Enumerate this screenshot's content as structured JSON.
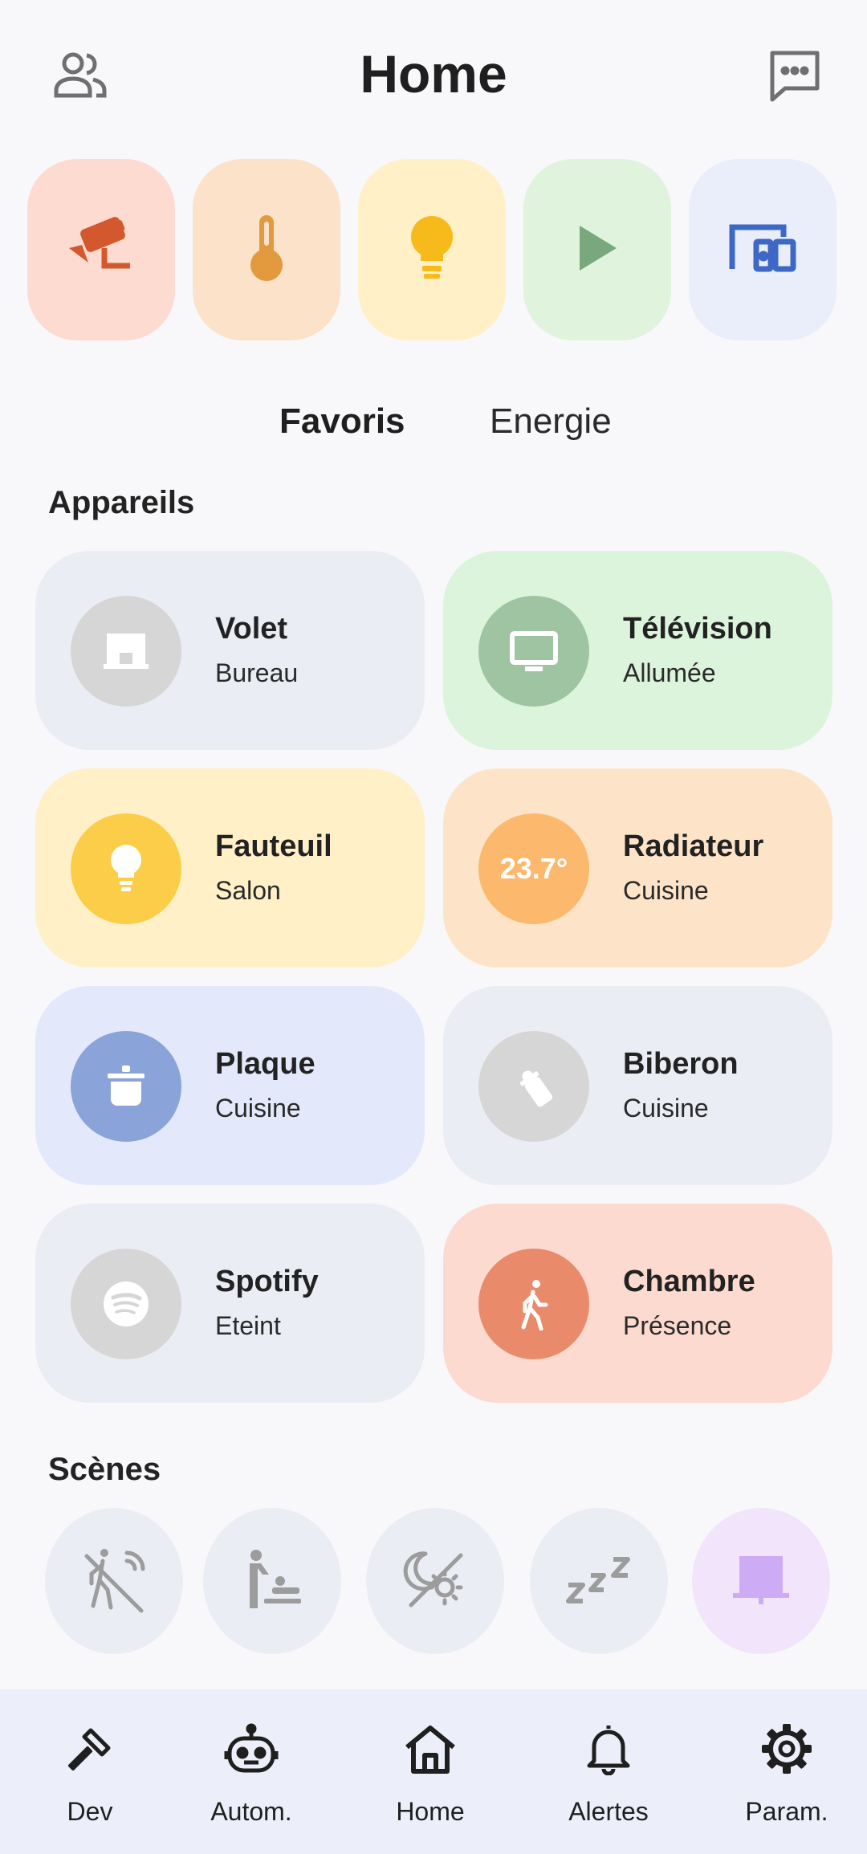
{
  "header": {
    "title": "Home",
    "left_icon": "people-icon",
    "right_icon": "message-icon"
  },
  "categories": [
    {
      "icon": "security-camera-icon",
      "bg": "#fddbd0",
      "color": "#d4582e"
    },
    {
      "icon": "thermometer-icon",
      "bg": "#fbe2c8",
      "color": "#e39a3f"
    },
    {
      "icon": "lightbulb-icon",
      "bg": "#fff0c8",
      "color": "#f6bb1b"
    },
    {
      "icon": "play-icon",
      "bg": "#dff3dd",
      "color": "#78a87c"
    },
    {
      "icon": "devices-icon",
      "bg": "#eaeefa",
      "color": "#3d68c5"
    }
  ],
  "tabs": [
    {
      "label": "Favoris",
      "active": true
    },
    {
      "label": "Energie",
      "active": false
    }
  ],
  "sections": {
    "devices": "Appareils",
    "scenes": "Scènes"
  },
  "devices": [
    {
      "name": "Volet",
      "status": "Bureau",
      "icon": "shutter-icon",
      "bg": "#eaedf4",
      "circle": "#d6d6d6"
    },
    {
      "name": "Télévision",
      "status": "Allumée",
      "icon": "tv-icon",
      "bg": "#dcf4dc",
      "circle": "#9ec4a1"
    },
    {
      "name": "Fauteuil",
      "status": "Salon",
      "icon": "lightbulb-icon",
      "bg": "#fff0c8",
      "circle": "#fbcd48"
    },
    {
      "name": "Radiateur",
      "status": "Cuisine",
      "icon": "temperature-readout",
      "temp": "23.7°",
      "bg": "#fde4c8",
      "circle": "#fcb96d"
    },
    {
      "name": "Plaque",
      "status": "Cuisine",
      "icon": "cooking-pot-icon",
      "bg": "#e3e8fb",
      "circle": "#8aa3d8"
    },
    {
      "name": "Biberon",
      "status": "Cuisine",
      "icon": "baby-bottle-icon",
      "bg": "#eaedf4",
      "circle": "#d6d6d6"
    },
    {
      "name": "Spotify",
      "status": "Eteint",
      "icon": "spotify-icon",
      "bg": "#eaedf4",
      "circle": "#d6d6d6"
    },
    {
      "name": "Chambre",
      "status": "Présence",
      "icon": "walking-person-icon",
      "bg": "#fcdad0",
      "circle": "#e98b6b"
    }
  ],
  "scenes": [
    {
      "icon": "no-presence-icon",
      "bg": "#eaedf4"
    },
    {
      "icon": "baby-changing-icon",
      "bg": "#eaedf4"
    },
    {
      "icon": "night-day-off-icon",
      "bg": "#eaedf4"
    },
    {
      "icon": "sleep-icon",
      "bg": "#eaedf4"
    },
    {
      "icon": "shutter-icon",
      "bg": "#f1e4fb"
    }
  ],
  "nav": [
    {
      "label": "Dev",
      "icon": "hammer-icon"
    },
    {
      "label": "Autom.",
      "icon": "robot-icon"
    },
    {
      "label": "Home",
      "icon": "home-icon",
      "active": true
    },
    {
      "label": "Alertes",
      "icon": "bell-icon"
    },
    {
      "label": "Param.",
      "icon": "gear-icon"
    }
  ]
}
